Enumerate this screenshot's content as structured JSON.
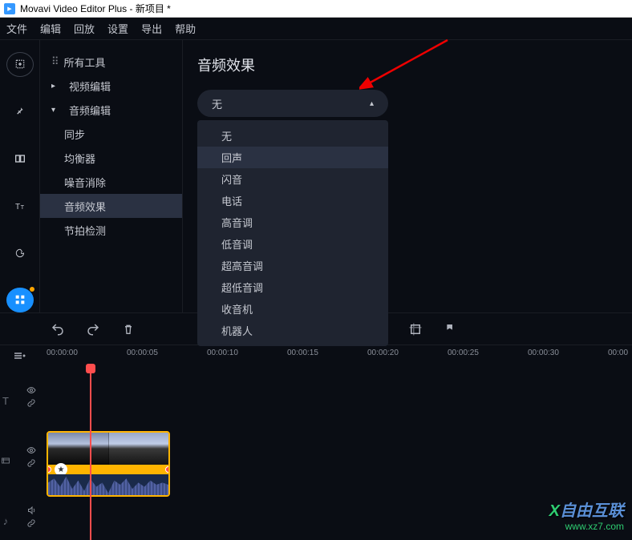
{
  "window": {
    "title": "Movavi Video Editor Plus - 新项目 *"
  },
  "menu": {
    "file": "文件",
    "edit": "编辑",
    "playback": "回放",
    "settings": "设置",
    "export": "导出",
    "help": "帮助"
  },
  "sidebar": {
    "all_tools": "所有工具",
    "video_edit": "视频编辑",
    "audio_edit": "音频编辑",
    "sync": "同步",
    "equalizer": "均衡器",
    "noise_removal": "噪音消除",
    "audio_effects": "音频效果",
    "beat_detection": "节拍检测"
  },
  "panel": {
    "title": "音频效果",
    "selected": "无",
    "options": [
      "无",
      "回声",
      "闪音",
      "电话",
      "高音调",
      "低音调",
      "超高音调",
      "超低音调",
      "收音机",
      "机器人"
    ]
  },
  "timeline": {
    "times": [
      "00:00:00",
      "00:00:05",
      "00:00:10",
      "00:00:15",
      "00:00:20",
      "00:00:25",
      "00:00:30",
      "00:00"
    ]
  },
  "watermark": {
    "brand": "自由互联",
    "url": "www.xz7.com"
  }
}
